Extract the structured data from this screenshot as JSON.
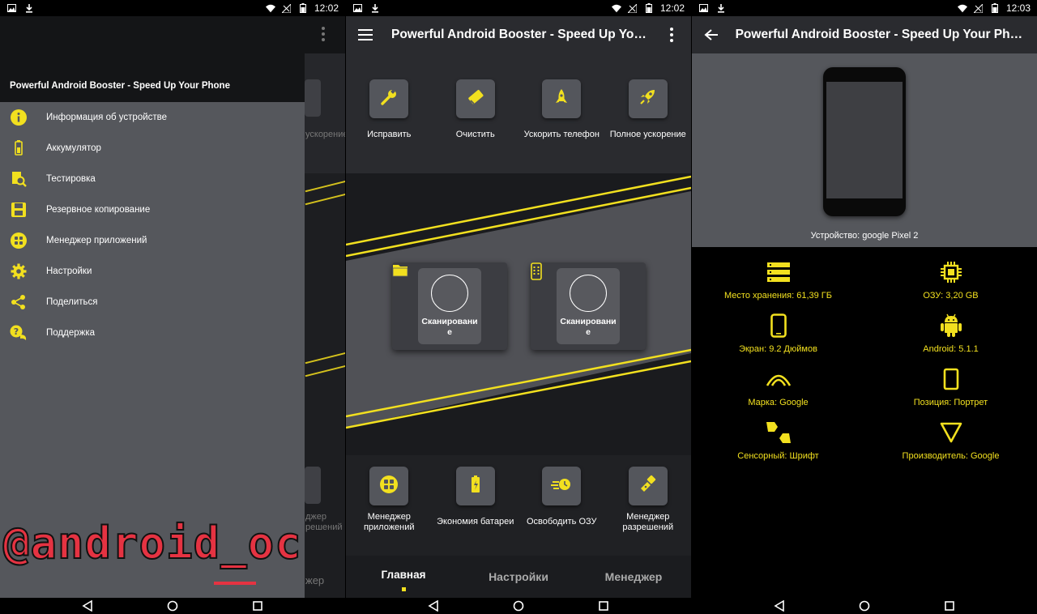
{
  "colors": {
    "accent": "#f2e01f",
    "drawer_bg": "#55575c",
    "toolbar_bg": "#2a2b2f",
    "watermark": "#e53342"
  },
  "status": {
    "time_1": "12:02",
    "time_2": "12:02",
    "time_3": "12:03"
  },
  "panel1": {
    "drawer_title": "Powerful Android Booster - Speed Up Your Phone",
    "items": [
      {
        "label": "Информация об устройстве",
        "icon": "info-icon"
      },
      {
        "label": "Аккумулятор",
        "icon": "battery-icon"
      },
      {
        "label": "Тестировка",
        "icon": "test-icon"
      },
      {
        "label": "Резервное копирование",
        "icon": "backup-icon"
      },
      {
        "label": "Менеджер приложений",
        "icon": "apps-grid-icon"
      },
      {
        "label": "Настройки",
        "icon": "gear-icon"
      },
      {
        "label": "Поделиться",
        "icon": "share-icon"
      },
      {
        "label": "Поддержка",
        "icon": "support-icon"
      }
    ],
    "bg_text_1": "ускорение",
    "bg_text_2": "джер",
    "bg_text_3": "решений",
    "bg_text_4": "жер",
    "watermark": "@android_oc"
  },
  "panel2": {
    "title": "Powerful Android Booster - Speed Up Your...",
    "top_actions": [
      {
        "label": "Исправить",
        "icon": "wrench-icon"
      },
      {
        "label": "Очистить",
        "icon": "eraser-icon"
      },
      {
        "label": "Ускорить телефон",
        "icon": "rocket-small-icon"
      },
      {
        "label": "Полное ускорение",
        "icon": "rocket-icon"
      }
    ],
    "scan_cards": [
      {
        "label": "Сканирование",
        "icon": "folder-icon"
      },
      {
        "label": "Сканирование",
        "icon": "phone-grid-icon"
      }
    ],
    "bottom_actions": [
      {
        "label": "Менеджер приложений",
        "icon": "apps-grid-icon"
      },
      {
        "label": "Экономия батареи",
        "icon": "battery-icon"
      },
      {
        "label": "Освободить ОЗУ",
        "icon": "ram-icon"
      },
      {
        "label": "Менеджер разрешений",
        "icon": "flashlight-icon"
      }
    ],
    "tabs": [
      {
        "label": "Главная",
        "active": true
      },
      {
        "label": "Настройки",
        "active": false
      },
      {
        "label": "Менеджер",
        "active": false
      }
    ]
  },
  "panel3": {
    "title": "Powerful Android Booster - Speed Up Your Phone",
    "device_label": "Устройство: google Pixel 2",
    "specs": [
      {
        "label": "Место хранения: 61,39 ГБ",
        "icon": "storage-icon"
      },
      {
        "label": "ОЗУ:  3,20 GB",
        "icon": "chip-icon"
      },
      {
        "label": "Экран: 9.2 Дюймов",
        "icon": "smartphone-icon"
      },
      {
        "label": "Android: 5.1.1",
        "icon": "android-icon"
      },
      {
        "label": "Марка: Google",
        "icon": "signal-arc-icon"
      },
      {
        "label": "Позиция: Портрет",
        "icon": "portrait-icon"
      },
      {
        "label": "Сенсорный: Шрифт",
        "icon": "touch-icon"
      },
      {
        "label": "Производитель: Google",
        "icon": "triangle-icon"
      }
    ]
  }
}
